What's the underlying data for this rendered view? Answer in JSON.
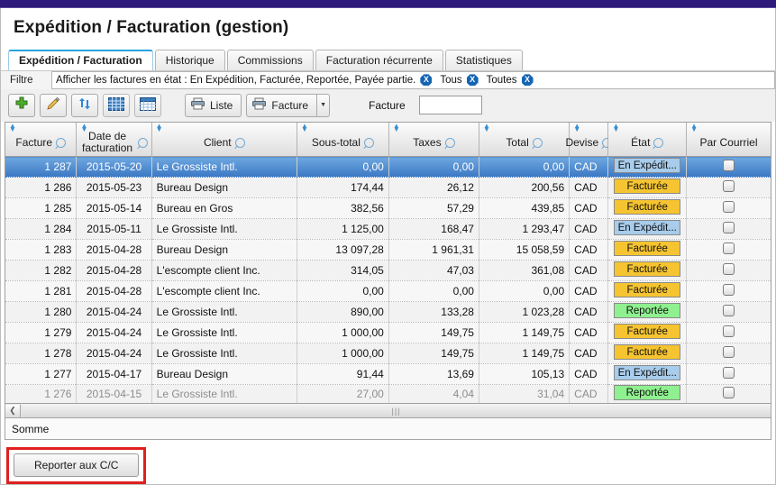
{
  "window": {
    "accent_bar_color": "#2e1a7a",
    "title": "Expédition / Facturation (gestion)"
  },
  "tabs": [
    {
      "label": "Expédition / Facturation",
      "active": true
    },
    {
      "label": "Historique",
      "active": false
    },
    {
      "label": "Commissions",
      "active": false
    },
    {
      "label": "Facturation récurrente",
      "active": false
    },
    {
      "label": "Statistiques",
      "active": false
    }
  ],
  "filter": {
    "label": "Filtre",
    "value": "Afficher les factures en état : En Expédition, Facturée, Reportée, Payée partie.",
    "clear_badge": "X",
    "segments": [
      {
        "label": "Tous",
        "clear_badge": "X"
      },
      {
        "label": "Toutes",
        "clear_badge": "X"
      }
    ]
  },
  "toolbar": {
    "add_icon": "plus-icon",
    "edit_icon": "pencil-icon",
    "refresh_icon": "refresh-icon",
    "grid_icon": "grid-icon",
    "table_icon": "table-icon",
    "print_list_label": "Liste",
    "print_invoice_label": "Facture",
    "split_arrow": "▼",
    "facture_label": "Facture",
    "facture_value": "",
    "facture_placeholder": ""
  },
  "grid": {
    "columns": [
      {
        "key": "facture",
        "label": "Facture",
        "align": "right",
        "width": "9.3%"
      },
      {
        "key": "date",
        "label": "Date de facturation",
        "align": "center",
        "width": "9.8%"
      },
      {
        "key": "client",
        "label": "Client",
        "align": "left",
        "width": "19.0%"
      },
      {
        "key": "sous_total",
        "label": "Sous-total",
        "align": "right",
        "width": "12.0%"
      },
      {
        "key": "taxes",
        "label": "Taxes",
        "align": "right",
        "width": "11.8%"
      },
      {
        "key": "total",
        "label": "Total",
        "align": "right",
        "width": "11.8%"
      },
      {
        "key": "devise",
        "label": "Devise",
        "align": "left",
        "width": "5.1%"
      },
      {
        "key": "etat",
        "label": "État",
        "align": "center",
        "width": "10.2%"
      },
      {
        "key": "courriel",
        "label": "Par Courriel",
        "align": "center",
        "width": "11.0%"
      }
    ],
    "status_colors": {
      "En Expédit...": "#a8cceb",
      "Facturée": "#f5c430",
      "Reportée": "#8ff08f"
    },
    "rows": [
      {
        "facture": "1 287",
        "date": "2015-05-20",
        "client": "Le Grossiste Intl.",
        "sous_total": "0,00",
        "taxes": "0,00",
        "total": "0,00",
        "devise": "CAD",
        "etat": "En Expédit...",
        "courriel": false,
        "selected": true
      },
      {
        "facture": "1 286",
        "date": "2015-05-23",
        "client": "Bureau Design",
        "sous_total": "174,44",
        "taxes": "26,12",
        "total": "200,56",
        "devise": "CAD",
        "etat": "Facturée",
        "courriel": false,
        "selected": false
      },
      {
        "facture": "1 285",
        "date": "2015-05-14",
        "client": "Bureau en Gros",
        "sous_total": "382,56",
        "taxes": "57,29",
        "total": "439,85",
        "devise": "CAD",
        "etat": "Facturée",
        "courriel": false,
        "selected": false
      },
      {
        "facture": "1 284",
        "date": "2015-05-11",
        "client": "Le Grossiste Intl.",
        "sous_total": "1 125,00",
        "taxes": "168,47",
        "total": "1 293,47",
        "devise": "CAD",
        "etat": "En Expédit...",
        "courriel": false,
        "selected": false
      },
      {
        "facture": "1 283",
        "date": "2015-04-28",
        "client": "Bureau Design",
        "sous_total": "13 097,28",
        "taxes": "1 961,31",
        "total": "15 058,59",
        "devise": "CAD",
        "etat": "Facturée",
        "courriel": false,
        "selected": false
      },
      {
        "facture": "1 282",
        "date": "2015-04-28",
        "client": "L'escompte client Inc.",
        "sous_total": "314,05",
        "taxes": "47,03",
        "total": "361,08",
        "devise": "CAD",
        "etat": "Facturée",
        "courriel": false,
        "selected": false
      },
      {
        "facture": "1 281",
        "date": "2015-04-28",
        "client": "L'escompte client Inc.",
        "sous_total": "0,00",
        "taxes": "0,00",
        "total": "0,00",
        "devise": "CAD",
        "etat": "Facturée",
        "courriel": false,
        "selected": false
      },
      {
        "facture": "1 280",
        "date": "2015-04-24",
        "client": "Le Grossiste Intl.",
        "sous_total": "890,00",
        "taxes": "133,28",
        "total": "1 023,28",
        "devise": "CAD",
        "etat": "Reportée",
        "courriel": false,
        "selected": false
      },
      {
        "facture": "1 279",
        "date": "2015-04-24",
        "client": "Le Grossiste Intl.",
        "sous_total": "1 000,00",
        "taxes": "149,75",
        "total": "1 149,75",
        "devise": "CAD",
        "etat": "Facturée",
        "courriel": false,
        "selected": false
      },
      {
        "facture": "1 278",
        "date": "2015-04-24",
        "client": "Le Grossiste Intl.",
        "sous_total": "1 000,00",
        "taxes": "149,75",
        "total": "1 149,75",
        "devise": "CAD",
        "etat": "Facturée",
        "courriel": false,
        "selected": false
      },
      {
        "facture": "1 277",
        "date": "2015-04-17",
        "client": "Bureau Design",
        "sous_total": "91,44",
        "taxes": "13,69",
        "total": "105,13",
        "devise": "CAD",
        "etat": "En Expédit...",
        "courriel": false,
        "selected": false
      },
      {
        "facture": "1 276",
        "date": "2015-04-15",
        "client": "Le Grossiste Intl.",
        "sous_total": "27,00",
        "taxes": "4,04",
        "total": "31,04",
        "devise": "CAD",
        "etat": "Reportée",
        "courriel": false,
        "selected": false,
        "partial": true
      }
    ]
  },
  "scrollbar": {
    "left_arrow": "❮",
    "grip": "|||"
  },
  "summary": {
    "label": "Somme"
  },
  "footer": {
    "report_button_label": "Reporter aux C/C",
    "highlight_color": "#e02020"
  }
}
